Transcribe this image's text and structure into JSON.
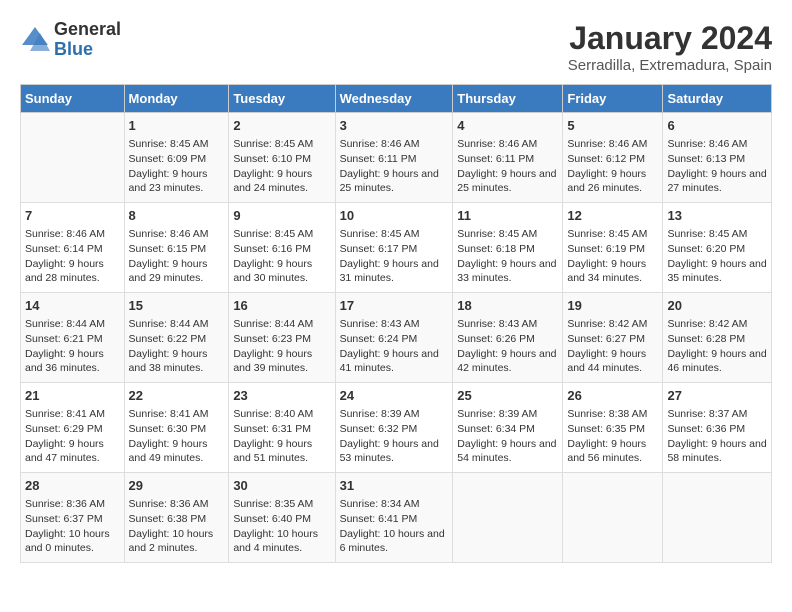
{
  "logo": {
    "general": "General",
    "blue": "Blue"
  },
  "title": "January 2024",
  "subtitle": "Serradilla, Extremadura, Spain",
  "days": [
    "Sunday",
    "Monday",
    "Tuesday",
    "Wednesday",
    "Thursday",
    "Friday",
    "Saturday"
  ],
  "weeks": [
    [
      {
        "num": "",
        "sunrise": "",
        "sunset": "",
        "daylight": ""
      },
      {
        "num": "1",
        "sunrise": "Sunrise: 8:45 AM",
        "sunset": "Sunset: 6:09 PM",
        "daylight": "Daylight: 9 hours and 23 minutes."
      },
      {
        "num": "2",
        "sunrise": "Sunrise: 8:45 AM",
        "sunset": "Sunset: 6:10 PM",
        "daylight": "Daylight: 9 hours and 24 minutes."
      },
      {
        "num": "3",
        "sunrise": "Sunrise: 8:46 AM",
        "sunset": "Sunset: 6:11 PM",
        "daylight": "Daylight: 9 hours and 25 minutes."
      },
      {
        "num": "4",
        "sunrise": "Sunrise: 8:46 AM",
        "sunset": "Sunset: 6:11 PM",
        "daylight": "Daylight: 9 hours and 25 minutes."
      },
      {
        "num": "5",
        "sunrise": "Sunrise: 8:46 AM",
        "sunset": "Sunset: 6:12 PM",
        "daylight": "Daylight: 9 hours and 26 minutes."
      },
      {
        "num": "6",
        "sunrise": "Sunrise: 8:46 AM",
        "sunset": "Sunset: 6:13 PM",
        "daylight": "Daylight: 9 hours and 27 minutes."
      }
    ],
    [
      {
        "num": "7",
        "sunrise": "Sunrise: 8:46 AM",
        "sunset": "Sunset: 6:14 PM",
        "daylight": "Daylight: 9 hours and 28 minutes."
      },
      {
        "num": "8",
        "sunrise": "Sunrise: 8:46 AM",
        "sunset": "Sunset: 6:15 PM",
        "daylight": "Daylight: 9 hours and 29 minutes."
      },
      {
        "num": "9",
        "sunrise": "Sunrise: 8:45 AM",
        "sunset": "Sunset: 6:16 PM",
        "daylight": "Daylight: 9 hours and 30 minutes."
      },
      {
        "num": "10",
        "sunrise": "Sunrise: 8:45 AM",
        "sunset": "Sunset: 6:17 PM",
        "daylight": "Daylight: 9 hours and 31 minutes."
      },
      {
        "num": "11",
        "sunrise": "Sunrise: 8:45 AM",
        "sunset": "Sunset: 6:18 PM",
        "daylight": "Daylight: 9 hours and 33 minutes."
      },
      {
        "num": "12",
        "sunrise": "Sunrise: 8:45 AM",
        "sunset": "Sunset: 6:19 PM",
        "daylight": "Daylight: 9 hours and 34 minutes."
      },
      {
        "num": "13",
        "sunrise": "Sunrise: 8:45 AM",
        "sunset": "Sunset: 6:20 PM",
        "daylight": "Daylight: 9 hours and 35 minutes."
      }
    ],
    [
      {
        "num": "14",
        "sunrise": "Sunrise: 8:44 AM",
        "sunset": "Sunset: 6:21 PM",
        "daylight": "Daylight: 9 hours and 36 minutes."
      },
      {
        "num": "15",
        "sunrise": "Sunrise: 8:44 AM",
        "sunset": "Sunset: 6:22 PM",
        "daylight": "Daylight: 9 hours and 38 minutes."
      },
      {
        "num": "16",
        "sunrise": "Sunrise: 8:44 AM",
        "sunset": "Sunset: 6:23 PM",
        "daylight": "Daylight: 9 hours and 39 minutes."
      },
      {
        "num": "17",
        "sunrise": "Sunrise: 8:43 AM",
        "sunset": "Sunset: 6:24 PM",
        "daylight": "Daylight: 9 hours and 41 minutes."
      },
      {
        "num": "18",
        "sunrise": "Sunrise: 8:43 AM",
        "sunset": "Sunset: 6:26 PM",
        "daylight": "Daylight: 9 hours and 42 minutes."
      },
      {
        "num": "19",
        "sunrise": "Sunrise: 8:42 AM",
        "sunset": "Sunset: 6:27 PM",
        "daylight": "Daylight: 9 hours and 44 minutes."
      },
      {
        "num": "20",
        "sunrise": "Sunrise: 8:42 AM",
        "sunset": "Sunset: 6:28 PM",
        "daylight": "Daylight: 9 hours and 46 minutes."
      }
    ],
    [
      {
        "num": "21",
        "sunrise": "Sunrise: 8:41 AM",
        "sunset": "Sunset: 6:29 PM",
        "daylight": "Daylight: 9 hours and 47 minutes."
      },
      {
        "num": "22",
        "sunrise": "Sunrise: 8:41 AM",
        "sunset": "Sunset: 6:30 PM",
        "daylight": "Daylight: 9 hours and 49 minutes."
      },
      {
        "num": "23",
        "sunrise": "Sunrise: 8:40 AM",
        "sunset": "Sunset: 6:31 PM",
        "daylight": "Daylight: 9 hours and 51 minutes."
      },
      {
        "num": "24",
        "sunrise": "Sunrise: 8:39 AM",
        "sunset": "Sunset: 6:32 PM",
        "daylight": "Daylight: 9 hours and 53 minutes."
      },
      {
        "num": "25",
        "sunrise": "Sunrise: 8:39 AM",
        "sunset": "Sunset: 6:34 PM",
        "daylight": "Daylight: 9 hours and 54 minutes."
      },
      {
        "num": "26",
        "sunrise": "Sunrise: 8:38 AM",
        "sunset": "Sunset: 6:35 PM",
        "daylight": "Daylight: 9 hours and 56 minutes."
      },
      {
        "num": "27",
        "sunrise": "Sunrise: 8:37 AM",
        "sunset": "Sunset: 6:36 PM",
        "daylight": "Daylight: 9 hours and 58 minutes."
      }
    ],
    [
      {
        "num": "28",
        "sunrise": "Sunrise: 8:36 AM",
        "sunset": "Sunset: 6:37 PM",
        "daylight": "Daylight: 10 hours and 0 minutes."
      },
      {
        "num": "29",
        "sunrise": "Sunrise: 8:36 AM",
        "sunset": "Sunset: 6:38 PM",
        "daylight": "Daylight: 10 hours and 2 minutes."
      },
      {
        "num": "30",
        "sunrise": "Sunrise: 8:35 AM",
        "sunset": "Sunset: 6:40 PM",
        "daylight": "Daylight: 10 hours and 4 minutes."
      },
      {
        "num": "31",
        "sunrise": "Sunrise: 8:34 AM",
        "sunset": "Sunset: 6:41 PM",
        "daylight": "Daylight: 10 hours and 6 minutes."
      },
      {
        "num": "",
        "sunrise": "",
        "sunset": "",
        "daylight": ""
      },
      {
        "num": "",
        "sunrise": "",
        "sunset": "",
        "daylight": ""
      },
      {
        "num": "",
        "sunrise": "",
        "sunset": "",
        "daylight": ""
      }
    ]
  ]
}
